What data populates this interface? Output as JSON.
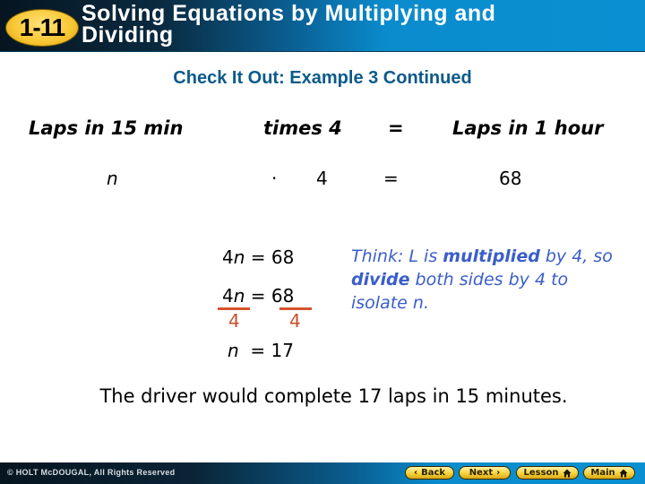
{
  "header": {
    "lesson_number": "1-11",
    "title_line1": "Solving Equations by Multiplying and",
    "title_line2": "Dividing"
  },
  "subtitle": "Check It Out: Example 3 Continued",
  "word_equation": {
    "headers": [
      "Laps in 15 min",
      "times 4",
      "=",
      "Laps in 1 hour"
    ],
    "values": [
      "n",
      "·",
      "4",
      "=",
      "68"
    ]
  },
  "work": {
    "step1": {
      "left_coef": "4",
      "left_var": "n",
      "eq": "=",
      "right": "68"
    },
    "step2": {
      "left_coef": "4",
      "left_var": "n",
      "eq": "=",
      "right": "68",
      "left_divisor": "4",
      "right_divisor": "4"
    },
    "step3": {
      "left_var": "n",
      "eq": "=",
      "right": "17"
    }
  },
  "think_note": {
    "part1": "Think: L is ",
    "bold1": "multiplied",
    "part2": " by 4, so ",
    "bold2": "divide",
    "part3": " both sides by 4 to isolate n."
  },
  "conclusion": "The driver would complete 17 laps in 15 minutes.",
  "footer": {
    "copyright": "© HOLT McDOUGAL, All Rights Reserved",
    "buttons": {
      "back": "Back",
      "next": "Next",
      "lesson": "Lesson",
      "main": "Main"
    },
    "icons": {
      "back": "chevron-left-icon",
      "next": "chevron-right-icon",
      "lesson": "home-icon",
      "main": "home-icon"
    }
  },
  "colors": {
    "subtitle": "#0b5a8a",
    "accent_orange": "#d6532c",
    "think_text": "#3a5ec9",
    "badge": "#f7c531"
  }
}
